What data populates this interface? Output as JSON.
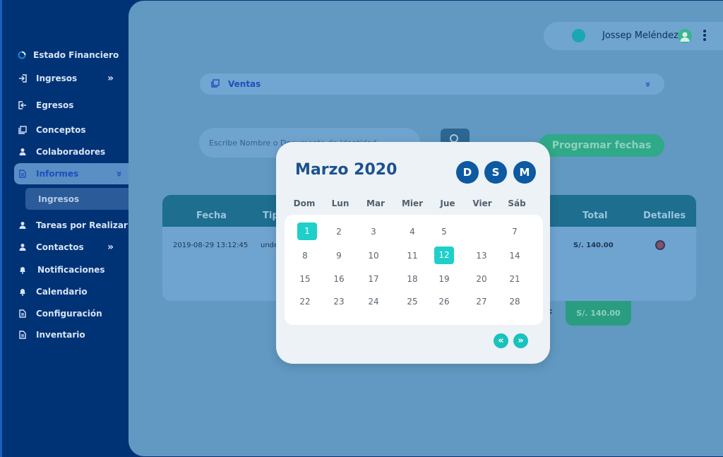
{
  "sidebar": {
    "items": [
      {
        "name": "estado-financiero",
        "label": "Estado Financiero",
        "icon": "loading-ring-icon"
      },
      {
        "name": "ingresos",
        "label": "Ingresos",
        "icon": "login-icon",
        "chevron": "»"
      },
      {
        "name": "egresos",
        "label": "Egresos",
        "icon": "logout-icon"
      },
      {
        "name": "conceptos",
        "label": "Conceptos",
        "icon": "stack-icon"
      },
      {
        "name": "colaboradores",
        "label": "Colaboradores",
        "icon": "user-icon"
      },
      {
        "name": "informes",
        "label": "Informes",
        "icon": "document-icon",
        "chevron": "»"
      },
      {
        "name": "tareas",
        "label": "Tareas por Realizar",
        "icon": "user-icon"
      },
      {
        "name": "contactos",
        "label": "Contactos",
        "icon": "user-icon",
        "chevron": "»"
      },
      {
        "name": "notificaciones",
        "label": "Notificaciones",
        "icon": "bell-icon"
      },
      {
        "name": "calendario",
        "label": "Calendario",
        "icon": "bell-icon"
      },
      {
        "name": "configuracion",
        "label": "Configuración",
        "icon": "document-icon"
      },
      {
        "name": "inventario",
        "label": "Inventario",
        "icon": "document-icon"
      }
    ],
    "submenu": {
      "label": "Ingresos"
    }
  },
  "header": {
    "user_name": "Jossep Meléndez"
  },
  "filter": {
    "select_label": "Ventas",
    "select_chevron": "»",
    "search_placeholder": "Escribe Nombre o Documento de Identidad",
    "schedule_button": "Programar fechas"
  },
  "table": {
    "columns": [
      "Fecha",
      "Tipo",
      "Total",
      "Detalles"
    ],
    "rows": [
      {
        "fecha": "2019-08-29  13:12:45",
        "tipo": "unde",
        "total": "S/. 140.00"
      }
    ],
    "footer_total": "S/. 140.00",
    "footer_colon": ":"
  },
  "calendar": {
    "title": "Marzo 2020",
    "view_buttons": [
      "D",
      "S",
      "M"
    ],
    "weekdays": [
      "Dom",
      "Lun",
      "Mar",
      "Mier",
      "Jue",
      "Vier",
      "Sáb"
    ],
    "weeks": [
      [
        "1",
        "2",
        "3",
        "4",
        "5",
        "",
        "7"
      ],
      [
        "8",
        "9",
        "10",
        "11",
        "12",
        "13",
        "14"
      ],
      [
        "15",
        "16",
        "17",
        "18",
        "19",
        "20",
        "21"
      ],
      [
        "22",
        "23",
        "24",
        "25",
        "26",
        "27",
        "28"
      ]
    ],
    "selected_days": [
      "1",
      "12"
    ],
    "prev_label": "«",
    "next_label": "»"
  },
  "colors": {
    "sidebar": "#003276",
    "main": "#6199c2",
    "accent_teal": "#1fcfc9",
    "calendar_blue": "#0d5aa3",
    "green": "#2fa987"
  }
}
